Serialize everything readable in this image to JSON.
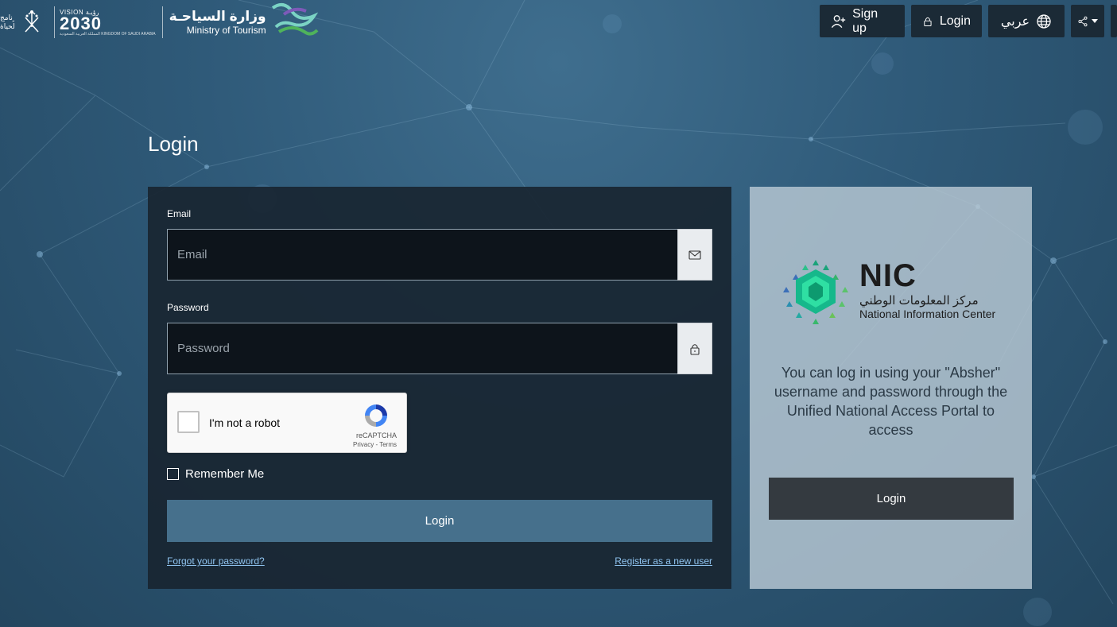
{
  "header": {
    "program_text": "برنامج الحياة",
    "vision": {
      "top": "VISION رؤيـة",
      "number": "2030",
      "sub": "المملكة العربية السعودية KINGDOM OF SAUDI ARABIA"
    },
    "ministry": {
      "arabic": "وزارة السياحـة",
      "english": "Ministry of Tourism"
    },
    "buttons": {
      "signup": {
        "label": "Sign up",
        "icon": "user-plus-icon"
      },
      "login": {
        "label": "Login",
        "icon": "lock-icon"
      },
      "language": {
        "label": "عربي",
        "icon": "globe-icon"
      },
      "share": {
        "icon": "share-icon"
      }
    }
  },
  "page_title": "Login",
  "login_form": {
    "email": {
      "label": "Email",
      "placeholder": "Email",
      "value": "",
      "icon": "envelope-icon"
    },
    "password": {
      "label": "Password",
      "placeholder": "Password",
      "value": "",
      "icon": "lock-icon"
    },
    "recaptcha": {
      "text": "I'm not a robot",
      "brand": "reCAPTCHA",
      "links": "Privacy - Terms"
    },
    "remember_me": "Remember Me",
    "submit_label": "Login",
    "forgot_link": "Forgot your password?",
    "register_link": "Register as a new user"
  },
  "nic_panel": {
    "logo_name": "NIC",
    "logo_arabic": "مركز المعلومات الوطني",
    "logo_english": "National Information Center",
    "description": "You can log in using your \"Absher\" username and password through the Unified National Access Portal to access",
    "button_label": "Login"
  },
  "colors": {
    "background": "#2f5a79",
    "header_button": "#1b2a36",
    "login_card": "#192631",
    "submit_button": "#46708c",
    "nic_card": "#bac9d4",
    "nic_button": "#343a40",
    "link": "#8fc3ef"
  }
}
